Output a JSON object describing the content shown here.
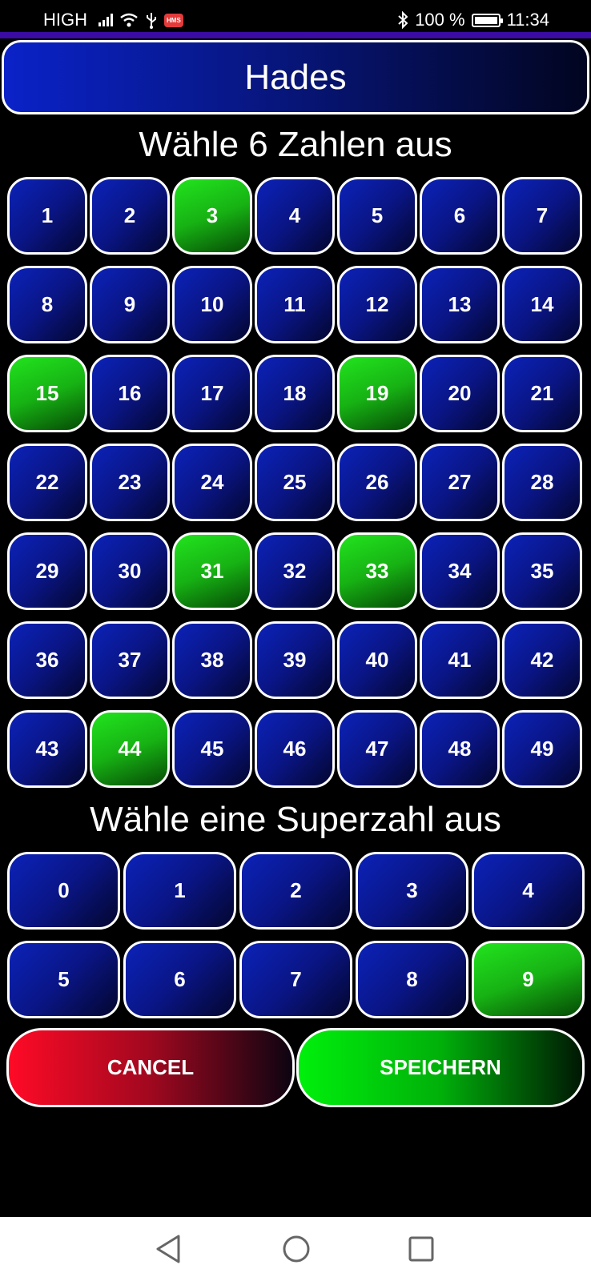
{
  "status_bar": {
    "network": "HIGH",
    "hms": "HMS",
    "battery": "100 %",
    "time": "11:34"
  },
  "title": "Hades",
  "main_heading": "Wähle 6 Zahlen aus",
  "numbers": [
    "1",
    "2",
    "3",
    "4",
    "5",
    "6",
    "7",
    "8",
    "9",
    "10",
    "11",
    "12",
    "13",
    "14",
    "15",
    "16",
    "17",
    "18",
    "19",
    "20",
    "21",
    "22",
    "23",
    "24",
    "25",
    "26",
    "27",
    "28",
    "29",
    "30",
    "31",
    "32",
    "33",
    "34",
    "35",
    "36",
    "37",
    "38",
    "39",
    "40",
    "41",
    "42",
    "43",
    "44",
    "45",
    "46",
    "47",
    "48",
    "49"
  ],
  "selected_numbers": [
    "3",
    "15",
    "19",
    "31",
    "33",
    "44"
  ],
  "super_heading": "Wähle eine Superzahl aus",
  "super_numbers": [
    "0",
    "1",
    "2",
    "3",
    "4",
    "5",
    "6",
    "7",
    "8",
    "9"
  ],
  "selected_super": "9",
  "buttons": {
    "cancel": "CANCEL",
    "save": "SPEICHERN"
  },
  "colors": {
    "selected": "#1fd61a",
    "unselected": "#0a1a9e",
    "cancel": "#ff0a26",
    "save": "#00f00c",
    "accent": "#3a0ca3"
  },
  "nav_icons": [
    "back-icon",
    "home-icon",
    "recents-icon"
  ]
}
